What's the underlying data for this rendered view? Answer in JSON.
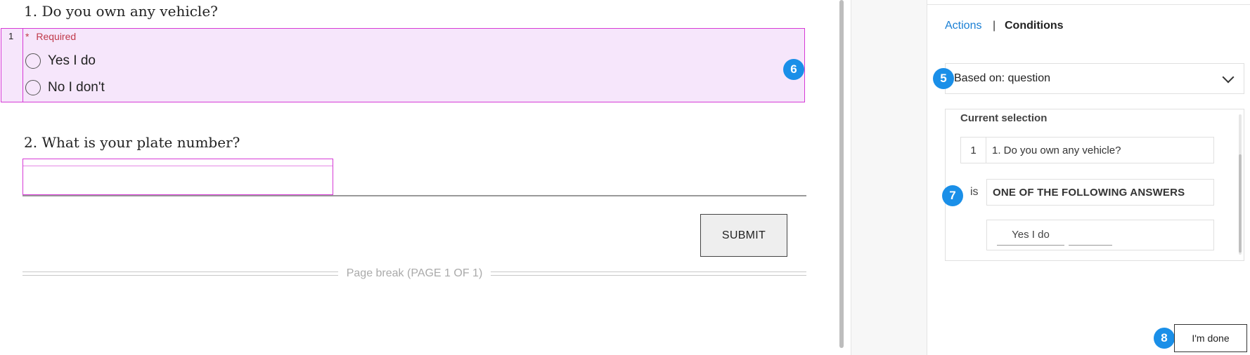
{
  "form": {
    "q1": {
      "number": "1",
      "title": "1. Do you own any vehicle?",
      "required_label": "Required",
      "required_marker": "*",
      "options": [
        "Yes I do",
        "No I don't"
      ]
    },
    "q2": {
      "title": "2. What is your plate number?",
      "value": ""
    },
    "submit_label": "SUBMIT",
    "page_break": "Page break (PAGE 1 OF 1)"
  },
  "badges": {
    "b5": "5",
    "b6": "6",
    "b7": "7",
    "b8": "8"
  },
  "panel": {
    "tabs": {
      "actions": "Actions",
      "separator": "|",
      "conditions": "Conditions"
    },
    "based_on": "Based on: question",
    "current_selection_label": "Current selection",
    "selected_number": "1",
    "selected_question": "1. Do you own any vehicle?",
    "is_label": "is",
    "operator": "ONE OF THE FOLLOWING ANSWERS",
    "answer_chip": "Yes I do",
    "done_label": "I'm done"
  },
  "colors": {
    "highlight_bg": "#f6e6fb",
    "highlight_border": "#d63ad6",
    "badge": "#1a8fe8",
    "link": "#1a7fd4",
    "required": "#c0394a"
  },
  "icons": {
    "select": "chevron-down-icon",
    "required": "asterisk-icon"
  }
}
